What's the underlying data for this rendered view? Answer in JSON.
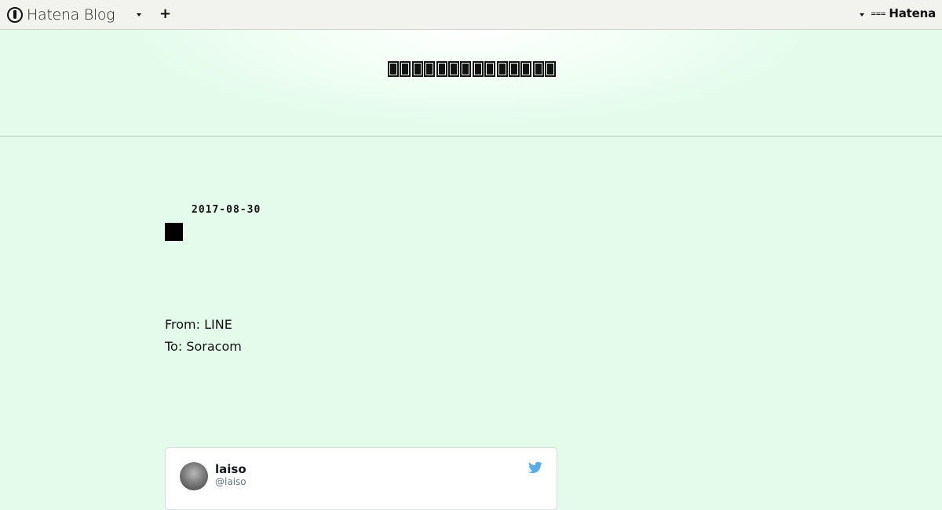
{
  "topbar": {
    "logo_text": "Hatena Blog",
    "plus_label": "+",
    "hatena_text": "Hatena"
  },
  "header": {
    "blog_title_glyph_count": 14
  },
  "entry": {
    "date": "2017-08-30",
    "body_lines": [
      "From: LINE",
      "To: Soracom"
    ]
  },
  "tweet": {
    "name": "laiso",
    "handle": "@laiso",
    "bird_color": "#55acee"
  }
}
